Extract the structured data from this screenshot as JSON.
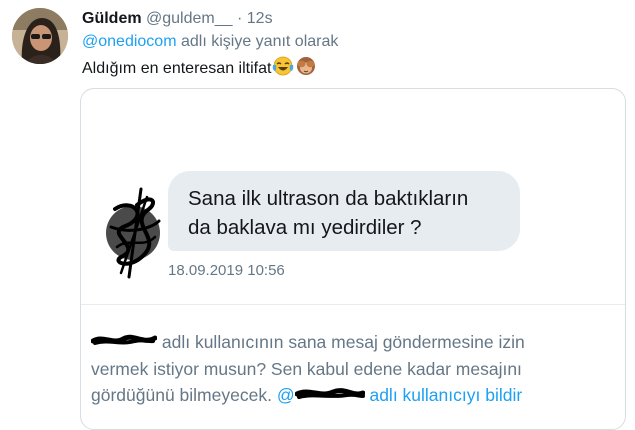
{
  "tweet": {
    "author_name": "Güldem",
    "author_handle": "@guldem__",
    "separator": "·",
    "timestamp": "12s",
    "reply_mention": "@onediocom",
    "reply_suffix": "adlı kişiye yanıt olarak",
    "text": "Aldığım en enteresan iltifat",
    "emojis": [
      "tears-of-joy-emoji",
      "see-no-evil-monkey-emoji"
    ]
  },
  "embedded_dm": {
    "message_lines": [
      "Sana ilk ultrason da baktıkların",
      "da baklava mı yedirdiler ?"
    ],
    "message_time": "18.09.2019 10:56",
    "notice": {
      "line1": "adlı kullanıcının sana mesaj göndermesine izin",
      "line2": "vermek istiyor musun? Sen kabul edene kadar mesajını",
      "line3_start": "gördüğünü bilmeyecek.",
      "line3_partial": "@",
      "report_link": "adlı kullanıcıyı bildir"
    }
  },
  "colors": {
    "text_primary": "#14171a",
    "text_secondary": "#657786",
    "link": "#1da1f2",
    "bubble": "#e6ecf0",
    "border": "#d6dde3"
  }
}
